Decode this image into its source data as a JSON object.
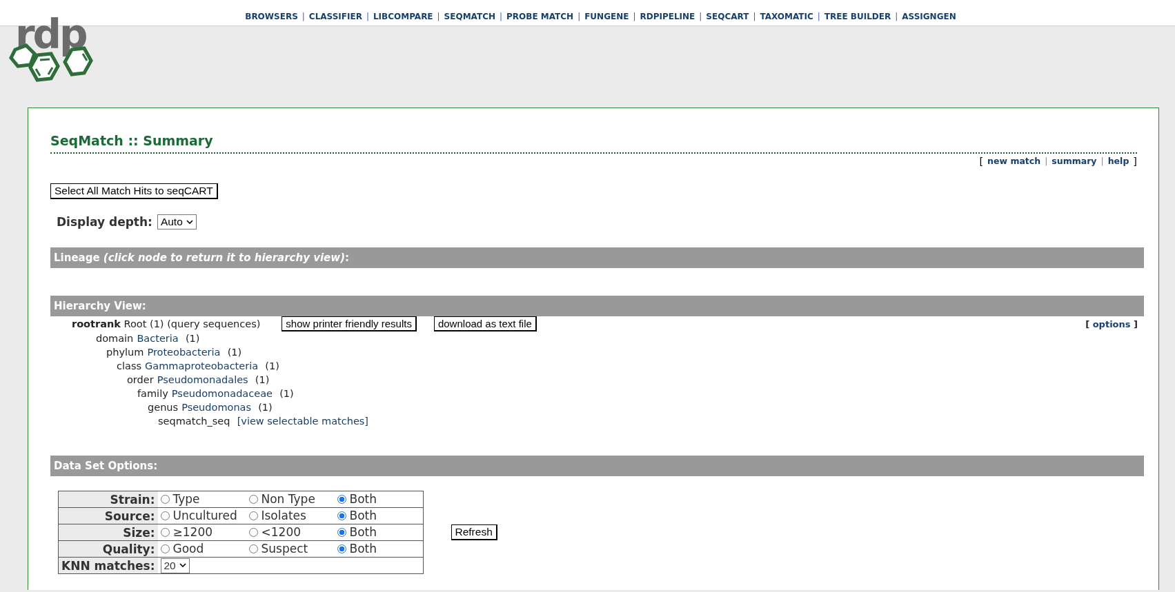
{
  "logo": {
    "text": "rdp"
  },
  "nav": {
    "separator": "|",
    "items": [
      "BROWSERS",
      "CLASSIFIER",
      "LIBCOMPARE",
      "SEQMATCH",
      "PROBE MATCH",
      "FUNGENE",
      "RDPIPELINE",
      "SEQCART",
      "TAXOMATIC",
      "TREE BUILDER",
      "ASSIGNGEN"
    ]
  },
  "page_title": "SeqMatch :: Summary",
  "top_links": {
    "open": "[",
    "close": "]",
    "separator": "|",
    "items": [
      "new match",
      "summary",
      "help"
    ]
  },
  "select_all_button": "Select All Match Hits to seqCART",
  "display_depth": {
    "label": "Display depth:",
    "value": "Auto"
  },
  "lineage_bar": {
    "label": "Lineage",
    "note": "(click node to return it to hierarchy view)",
    "suffix": ":"
  },
  "hierarchy_bar": "Hierarchy View:",
  "hierarchy_buttons": [
    "show printer friendly results",
    "download as text file"
  ],
  "options_link": {
    "open": "[",
    "label": "options",
    "close": "]"
  },
  "tree": {
    "kind": "root",
    "rank": "rootrank",
    "name": "Root",
    "count": "(1)",
    "note": "(query sequences)",
    "children": [
      {
        "kind": "taxon",
        "rank": "domain",
        "name": "Bacteria",
        "count": "(1)",
        "children": [
          {
            "kind": "taxon",
            "rank": "phylum",
            "name": "Proteobacteria",
            "count": "(1)",
            "children": [
              {
                "kind": "taxon",
                "rank": "class",
                "name": "Gammaproteobacteria",
                "count": "(1)",
                "children": [
                  {
                    "kind": "taxon",
                    "rank": "order",
                    "name": "Pseudomonadales",
                    "count": "(1)",
                    "children": [
                      {
                        "kind": "taxon",
                        "rank": "family",
                        "name": "Pseudomonadaceae",
                        "count": "(1)",
                        "children": [
                          {
                            "kind": "taxon",
                            "rank": "genus",
                            "name": "Pseudomonas",
                            "count": "(1)",
                            "children": [
                              {
                                "kind": "sequence",
                                "name": "seqmatch_seq",
                                "link": "[view selectable matches]"
                              }
                            ]
                          }
                        ]
                      }
                    ]
                  }
                ]
              }
            ]
          }
        ]
      }
    ]
  },
  "data_set_bar": "Data Set Options:",
  "options": [
    {
      "label": "Strain:",
      "choices": [
        {
          "label": "Type",
          "selected": false
        },
        {
          "label": "Non Type",
          "selected": false
        },
        {
          "label": "Both",
          "selected": true
        }
      ]
    },
    {
      "label": "Source:",
      "choices": [
        {
          "label": "Uncultured",
          "selected": false
        },
        {
          "label": "Isolates",
          "selected": false
        },
        {
          "label": "Both",
          "selected": true
        }
      ]
    },
    {
      "label": "Size:",
      "choices": [
        {
          "label": "≥1200",
          "selected": false
        },
        {
          "label": "<1200",
          "selected": false
        },
        {
          "label": "Both",
          "selected": true
        }
      ]
    },
    {
      "label": "Quality:",
      "choices": [
        {
          "label": "Good",
          "selected": false
        },
        {
          "label": "Suspect",
          "selected": false
        },
        {
          "label": "Both",
          "selected": true
        }
      ]
    }
  ],
  "knn": {
    "label": "KNN matches:",
    "value": "20"
  },
  "refresh_button": "Refresh"
}
